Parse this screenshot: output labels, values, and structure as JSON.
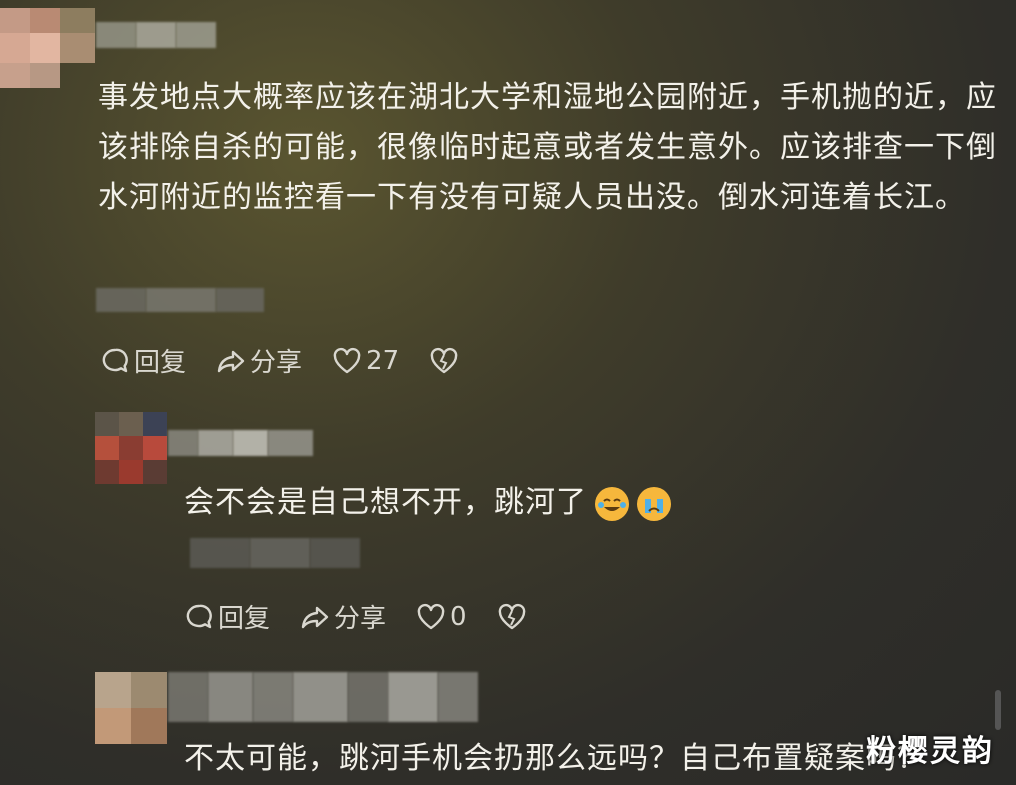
{
  "comments": [
    {
      "text": "事发地点大概率应该在湖北大学和湿地公园附近，手机抛的近，应该排除自杀的可能，很像临时起意或者发生意外。应该排查一下倒水河附近的监控看一下有没有可疑人员出没。倒水河连着长江。",
      "reply_label": "回复",
      "share_label": "分享",
      "likes": "27"
    },
    {
      "text": "会不会是自己想不开，跳河了",
      "emojis": [
        "laugh-cry-emoji",
        "crying-emoji"
      ],
      "reply_label": "回复",
      "share_label": "分享",
      "likes": "0"
    },
    {
      "text": "不太可能，跳河手机会扔那么远吗？自己布置疑案吗？"
    }
  ],
  "watermark": "粉樱灵韵",
  "colors": {
    "background": "#3b3a2c",
    "text": "#f3f1ea",
    "action_text": "#d9d7cf"
  }
}
